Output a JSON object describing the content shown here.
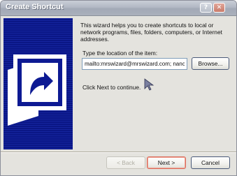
{
  "window": {
    "title": "Create Shortcut",
    "help_glyph": "?",
    "close_glyph": "✕"
  },
  "banner": {
    "icon": "shortcut-arrow-icon"
  },
  "main": {
    "intro": "This wizard helps you to create shortcuts to local or network programs, files, folders, computers, or Internet addresses.",
    "location_label": "Type the location of the item:",
    "location_value": "mailto:mrswizard@mrswizard.com; nancy",
    "browse_label": "Browse...",
    "continue_hint": "Click Next to continue."
  },
  "footer": {
    "back_label": "< Back",
    "next_label": "Next >",
    "cancel_label": "Cancel"
  },
  "colors": {
    "banner": "#0d1a93",
    "default_button_border": "#d96c5c"
  }
}
